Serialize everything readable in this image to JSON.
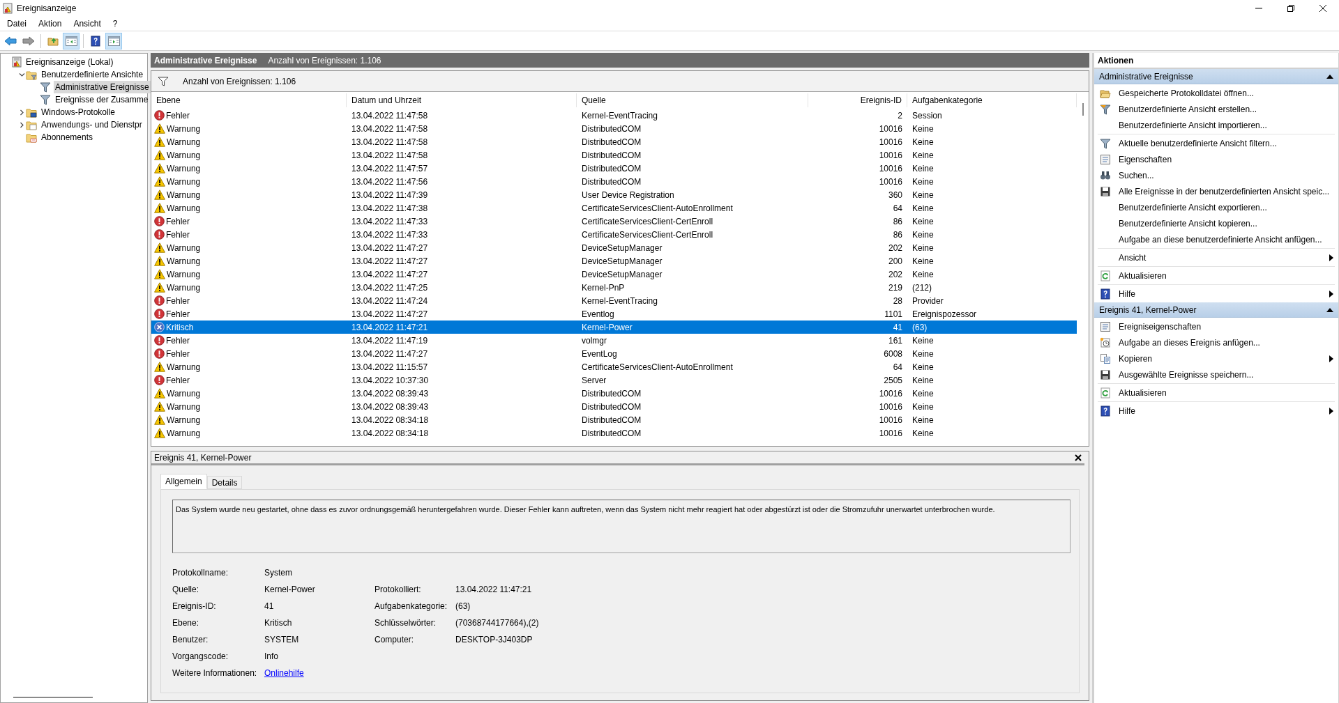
{
  "window": {
    "title": "Ereignisanzeige"
  },
  "menu": [
    "Datei",
    "Aktion",
    "Ansicht",
    "?"
  ],
  "toolbar": {
    "console_tree_shown": true,
    "action_pane_shown": true
  },
  "tree": [
    {
      "label": "Ereignisanzeige (Lokal)",
      "kind": "root",
      "selected": false,
      "children": [
        {
          "label": "Benutzerdefinierte Ansichte",
          "kind": "views",
          "expanded": true,
          "selected": false,
          "children": [
            {
              "label": "Administrative Ereignisse",
              "kind": "filter",
              "selected": true
            },
            {
              "label": "Ereignisse der Zusamme",
              "kind": "filter",
              "selected": false
            }
          ]
        },
        {
          "label": "Windows-Protokolle",
          "kind": "logs",
          "expanded": false,
          "selected": false
        },
        {
          "label": "Anwendungs- und Dienstpr",
          "kind": "apps",
          "expanded": false,
          "selected": false
        },
        {
          "label": "Abonnements",
          "kind": "subs",
          "selected": false
        }
      ]
    }
  ],
  "header": {
    "title": "Administrative Ereignisse",
    "count": "Anzahl von Ereignissen: 1.106"
  },
  "filter_bar": {
    "text": "Anzahl von Ereignissen: 1.106"
  },
  "table": {
    "columns": [
      "Ebene",
      "Datum und Uhrzeit",
      "Quelle",
      "Ereignis-ID",
      "Aufgabenkategorie"
    ],
    "rows": [
      {
        "kind": "error",
        "severity": "Fehler",
        "date": "13.04.2022 11:47:58",
        "source": "Kernel-EventTracing",
        "id": "2",
        "category": "Session",
        "selected": false
      },
      {
        "kind": "warning",
        "severity": "Warnung",
        "date": "13.04.2022 11:47:58",
        "source": "DistributedCOM",
        "id": "10016",
        "category": "Keine",
        "selected": false
      },
      {
        "kind": "warning",
        "severity": "Warnung",
        "date": "13.04.2022 11:47:58",
        "source": "DistributedCOM",
        "id": "10016",
        "category": "Keine",
        "selected": false
      },
      {
        "kind": "warning",
        "severity": "Warnung",
        "date": "13.04.2022 11:47:58",
        "source": "DistributedCOM",
        "id": "10016",
        "category": "Keine",
        "selected": false
      },
      {
        "kind": "warning",
        "severity": "Warnung",
        "date": "13.04.2022 11:47:57",
        "source": "DistributedCOM",
        "id": "10016",
        "category": "Keine",
        "selected": false
      },
      {
        "kind": "warning",
        "severity": "Warnung",
        "date": "13.04.2022 11:47:56",
        "source": "DistributedCOM",
        "id": "10016",
        "category": "Keine",
        "selected": false
      },
      {
        "kind": "warning",
        "severity": "Warnung",
        "date": "13.04.2022 11:47:39",
        "source": "User Device Registration",
        "id": "360",
        "category": "Keine",
        "selected": false
      },
      {
        "kind": "warning",
        "severity": "Warnung",
        "date": "13.04.2022 11:47:38",
        "source": "CertificateServicesClient-AutoEnrollment",
        "id": "64",
        "category": "Keine",
        "selected": false
      },
      {
        "kind": "error",
        "severity": "Fehler",
        "date": "13.04.2022 11:47:33",
        "source": "CertificateServicesClient-CertEnroll",
        "id": "86",
        "category": "Keine",
        "selected": false
      },
      {
        "kind": "error",
        "severity": "Fehler",
        "date": "13.04.2022 11:47:33",
        "source": "CertificateServicesClient-CertEnroll",
        "id": "86",
        "category": "Keine",
        "selected": false
      },
      {
        "kind": "warning",
        "severity": "Warnung",
        "date": "13.04.2022 11:47:27",
        "source": "DeviceSetupManager",
        "id": "202",
        "category": "Keine",
        "selected": false
      },
      {
        "kind": "warning",
        "severity": "Warnung",
        "date": "13.04.2022 11:47:27",
        "source": "DeviceSetupManager",
        "id": "200",
        "category": "Keine",
        "selected": false
      },
      {
        "kind": "warning",
        "severity": "Warnung",
        "date": "13.04.2022 11:47:27",
        "source": "DeviceSetupManager",
        "id": "202",
        "category": "Keine",
        "selected": false
      },
      {
        "kind": "warning",
        "severity": "Warnung",
        "date": "13.04.2022 11:47:25",
        "source": "Kernel-PnP",
        "id": "219",
        "category": "(212)",
        "selected": false
      },
      {
        "kind": "error",
        "severity": "Fehler",
        "date": "13.04.2022 11:47:24",
        "source": "Kernel-EventTracing",
        "id": "28",
        "category": "Provider",
        "selected": false
      },
      {
        "kind": "error",
        "severity": "Fehler",
        "date": "13.04.2022 11:47:27",
        "source": "Eventlog",
        "id": "1101",
        "category": "Ereignispozessor",
        "selected": false
      },
      {
        "kind": "critical",
        "severity": "Kritisch",
        "date": "13.04.2022 11:47:21",
        "source": "Kernel-Power",
        "id": "41",
        "category": "(63)",
        "selected": true
      },
      {
        "kind": "error",
        "severity": "Fehler",
        "date": "13.04.2022 11:47:19",
        "source": "volmgr",
        "id": "161",
        "category": "Keine",
        "selected": false
      },
      {
        "kind": "error",
        "severity": "Fehler",
        "date": "13.04.2022 11:47:27",
        "source": "EventLog",
        "id": "6008",
        "category": "Keine",
        "selected": false
      },
      {
        "kind": "warning",
        "severity": "Warnung",
        "date": "13.04.2022 11:15:57",
        "source": "CertificateServicesClient-AutoEnrollment",
        "id": "64",
        "category": "Keine",
        "selected": false
      },
      {
        "kind": "error",
        "severity": "Fehler",
        "date": "13.04.2022 10:37:30",
        "source": "Server",
        "id": "2505",
        "category": "Keine",
        "selected": false
      },
      {
        "kind": "warning",
        "severity": "Warnung",
        "date": "13.04.2022 08:39:43",
        "source": "DistributedCOM",
        "id": "10016",
        "category": "Keine",
        "selected": false
      },
      {
        "kind": "warning",
        "severity": "Warnung",
        "date": "13.04.2022 08:39:43",
        "source": "DistributedCOM",
        "id": "10016",
        "category": "Keine",
        "selected": false
      },
      {
        "kind": "warning",
        "severity": "Warnung",
        "date": "13.04.2022 08:34:18",
        "source": "DistributedCOM",
        "id": "10016",
        "category": "Keine",
        "selected": false
      },
      {
        "kind": "warning",
        "severity": "Warnung",
        "date": "13.04.2022 08:34:18",
        "source": "DistributedCOM",
        "id": "10016",
        "category": "Keine",
        "selected": false
      }
    ]
  },
  "detail": {
    "title": "Ereignis 41, Kernel-Power",
    "tabs": [
      {
        "label": "Allgemein",
        "selected": true
      },
      {
        "label": "Details",
        "selected": false
      }
    ],
    "description": "Das System wurde neu gestartet, ohne dass es zuvor ordnungsgemäß heruntergefahren wurde. Dieser Fehler kann auftreten, wenn das System nicht mehr reagiert hat oder abgestürzt ist oder die Stromzufuhr unerwartet unterbrochen wurde.",
    "rows": [
      {
        "label": "Protokollname:",
        "value": "System"
      },
      {
        "label": "Quelle:",
        "value": "Kernel-Power",
        "label_2": "Protokolliert:",
        "value_2": "13.04.2022 11:47:21"
      },
      {
        "label": "Ereignis-ID:",
        "value": "41",
        "label_2": "Aufgabenkategorie:",
        "value_2": "(63)"
      },
      {
        "label": "Ebene:",
        "value": "Kritisch",
        "label_2": "Schlüsselwörter:",
        "value_2": "(70368744177664),(2)"
      },
      {
        "label": "Benutzer:",
        "value": "SYSTEM",
        "label_2": "Computer:",
        "value_2": "DESKTOP-3J403DP"
      },
      {
        "label": "Vorgangscode:",
        "value": "Info"
      }
    ],
    "more_info": {
      "label": "Weitere Informationen:",
      "link": "Onlinehilfe"
    }
  },
  "actions": {
    "title": "Aktionen",
    "sections": [
      {
        "title": "Administrative Ereignisse",
        "expanded": true,
        "groups": [
          [
            {
              "label": "Gespeicherte Protokolldatei öffnen...",
              "submenu": false
            },
            {
              "label": "Benutzerdefinierte Ansicht erstellen...",
              "submenu": false
            },
            {
              "label": "Benutzerdefinierte Ansicht importieren...",
              "submenu": false
            }
          ],
          [
            {
              "label": "Aktuelle benutzerdefinierte Ansicht filtern...",
              "submenu": false
            },
            {
              "label": "Eigenschaften",
              "submenu": false
            },
            {
              "label": "Suchen...",
              "submenu": false
            },
            {
              "label": "Alle Ereignisse in der benutzerdefinierten Ansicht speic...",
              "submenu": false
            },
            {
              "label": "Benutzerdefinierte Ansicht exportieren...",
              "submenu": false
            },
            {
              "label": "Benutzerdefinierte Ansicht kopieren...",
              "submenu": false
            },
            {
              "label": "Aufgabe an diese benutzerdefinierte Ansicht anfügen...",
              "submenu": false
            }
          ],
          [
            {
              "label": "Ansicht",
              "submenu": true
            }
          ],
          [
            {
              "label": "Aktualisieren",
              "submenu": false
            }
          ],
          [
            {
              "label": "Hilfe",
              "submenu": true
            }
          ]
        ]
      },
      {
        "title": "Ereignis 41, Kernel-Power",
        "expanded": true,
        "groups": [
          [
            {
              "label": "Ereigniseigenschaften",
              "submenu": false
            },
            {
              "label": "Aufgabe an dieses Ereignis anfügen...",
              "submenu": false
            },
            {
              "label": "Kopieren",
              "submenu": true
            },
            {
              "label": "Ausgewählte Ereignisse speichern...",
              "submenu": false
            }
          ],
          [
            {
              "label": "Aktualisieren",
              "submenu": false
            }
          ],
          [
            {
              "label": "Hilfe",
              "submenu": true
            }
          ]
        ]
      }
    ]
  }
}
